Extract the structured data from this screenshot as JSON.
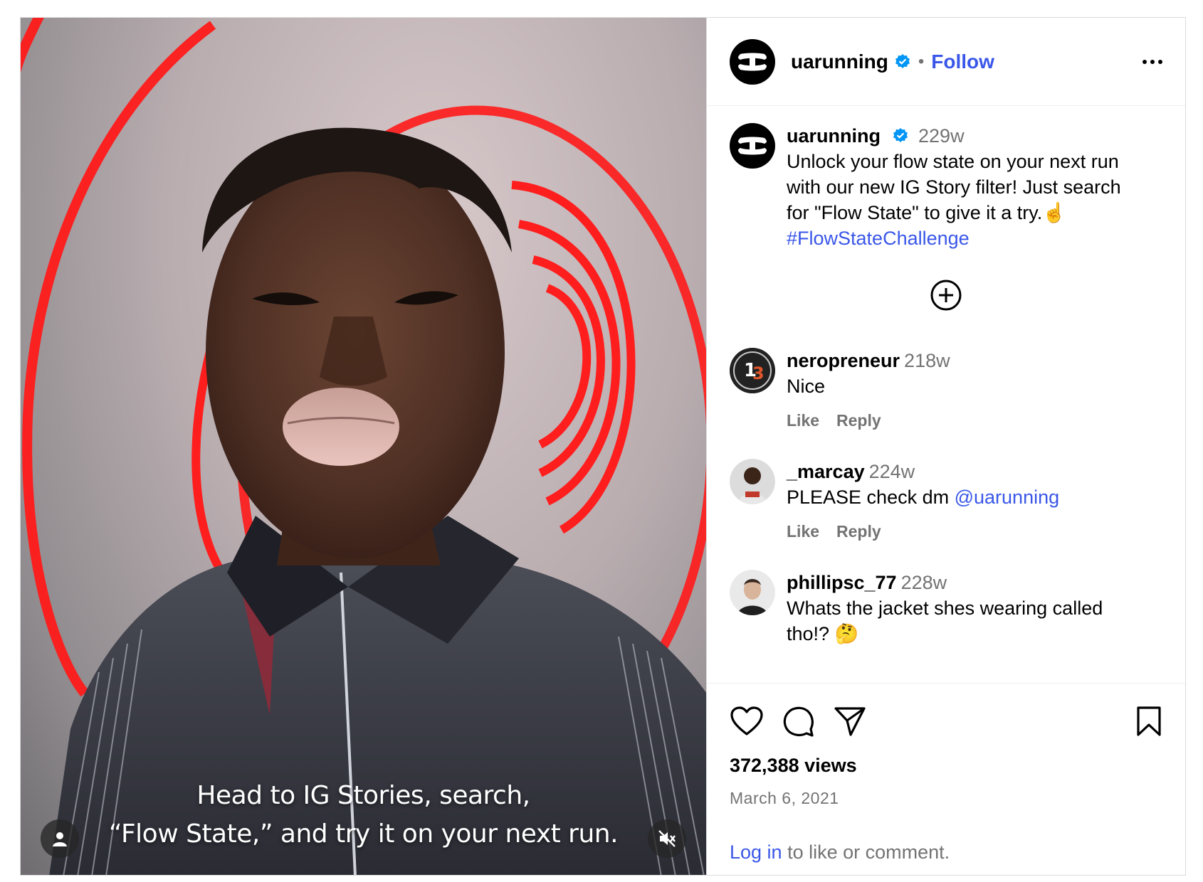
{
  "post": {
    "author": "uarunning",
    "follow_label": "Follow",
    "separator": "•",
    "video_caption_line1": "Head to IG Stories, search,",
    "video_caption_line2": "“Flow State,” and try it on your next run."
  },
  "caption": {
    "author": "uarunning",
    "time": "229w",
    "line1": "Unlock your flow state on your next run",
    "line2": "with our new IG Story filter! Just search",
    "line3": "for \"Flow State\" to give it a try.☝️",
    "hashtag": "#FlowStateChallenge"
  },
  "comments": [
    {
      "user": "neropreneur",
      "time": "218w",
      "text": "Nice",
      "like": "Like",
      "reply": "Reply"
    },
    {
      "user": "_marcay",
      "time": "224w",
      "text": "PLEASE check dm ",
      "mention": "@uarunning",
      "like": "Like",
      "reply": "Reply"
    },
    {
      "user": "phillipsc_77",
      "time": "228w",
      "text_line1": "Whats the jacket shes wearing called",
      "text_line2": "tho!? 🤔"
    }
  ],
  "stats": {
    "views": "372,388 views",
    "date": "March 6, 2021"
  },
  "login": {
    "link": "Log in",
    "rest": " to like or comment."
  },
  "colors": {
    "link_blue": "#3a57e8",
    "verified_blue": "#0095f6",
    "muted_gray": "#737373",
    "ring_red": "#ff1a1a"
  },
  "icons": [
    "user-icon",
    "mute-icon",
    "verified-icon",
    "more-icon",
    "add-circle-icon",
    "heart-icon",
    "comment-icon",
    "share-icon",
    "bookmark-icon"
  ]
}
